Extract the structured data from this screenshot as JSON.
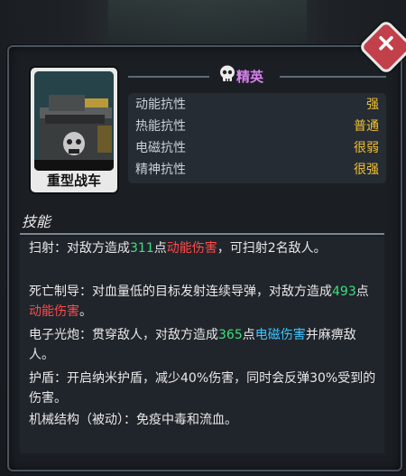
{
  "unit": {
    "name": "重型战车",
    "rank": "精英",
    "rank_color": "#d880ee"
  },
  "resistances": [
    {
      "label": "动能抗性",
      "value": "强"
    },
    {
      "label": "热能抗性",
      "value": "普通"
    },
    {
      "label": "电磁抗性",
      "value": "很弱"
    },
    {
      "label": "精神抗性",
      "value": "很强"
    }
  ],
  "skills": {
    "title": "技能",
    "items": [
      {
        "parts": [
          "扫射：对敌方造成",
          "311",
          "点",
          "动能伤害",
          "，可扫射2名敌人。"
        ]
      },
      {
        "parts": [
          "死亡制导：对血量低的目标发射连续导弹，对敌方造成",
          "493",
          "点",
          "动能伤害",
          "。"
        ]
      },
      {
        "parts": [
          "电子光炮：贯穿敌人，对敌方造成",
          "365",
          "点",
          "电磁伤害",
          "并麻痹敌人。"
        ]
      },
      {
        "text": "护盾：开启纳米护盾，减少40%伤害，同时会反弹30%受到的伤害。"
      },
      {
        "text": "机械结构（被动）：免疫中毒和流血。"
      }
    ]
  },
  "icons": {
    "close": "close-icon",
    "rank": "skull-icon"
  },
  "colors": {
    "damage_kinetic": "#ff4b4b",
    "damage_em": "#3ac6ff",
    "number": "#3be07c",
    "resistance_value": "#f1c232"
  }
}
